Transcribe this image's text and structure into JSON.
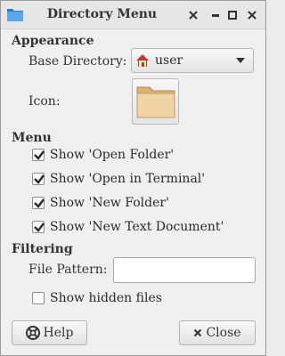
{
  "window": {
    "title": "Directory Menu",
    "controls": [
      "minimize-icon",
      "maximize-icon",
      "close-icon"
    ]
  },
  "appearance": {
    "header": "Appearance",
    "base_directory_label": "Base Directory:",
    "base_directory_value": "user",
    "icon_label": "Icon:"
  },
  "menu": {
    "header": "Menu",
    "items": [
      {
        "label": "Show 'Open Folder'",
        "checked": true
      },
      {
        "label": "Show 'Open in Terminal'",
        "checked": true
      },
      {
        "label": "Show 'New Folder'",
        "checked": true
      },
      {
        "label": "Show 'New Text Document'",
        "checked": true
      }
    ]
  },
  "filtering": {
    "header": "Filtering",
    "file_pattern_label": "File Pattern:",
    "file_pattern_value": "",
    "show_hidden_label": "Show hidden files",
    "show_hidden_checked": false
  },
  "buttons": {
    "help_label": "Help",
    "close_label": "Close"
  },
  "colors": {
    "folder": "#e8c48a",
    "check": "#2a2a2a",
    "app_icon": "#3d8fd6"
  }
}
